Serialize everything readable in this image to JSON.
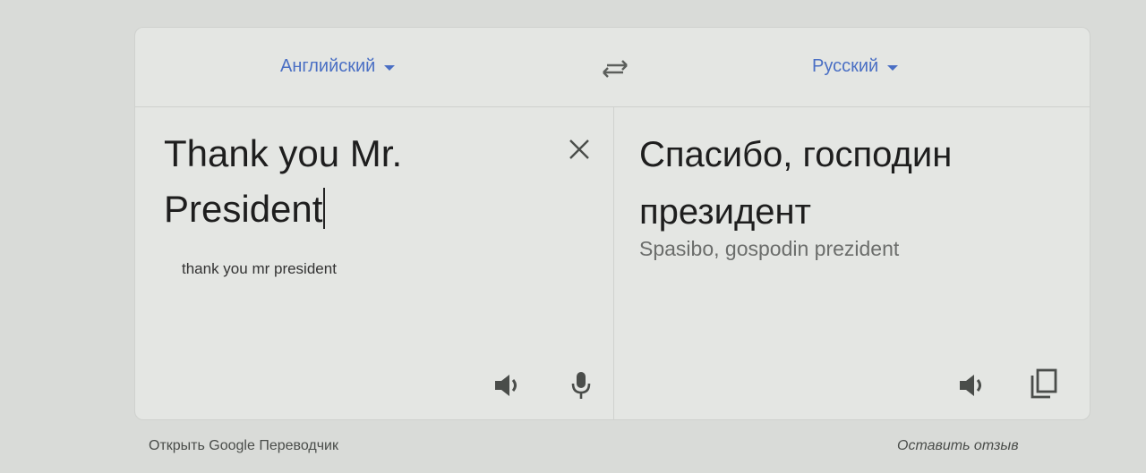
{
  "header": {
    "source_language": "Английский",
    "target_language": "Русский"
  },
  "source": {
    "text": "Thank you Mr. President",
    "transliteration": "thank you mr president"
  },
  "target": {
    "text": "Спасибо, господин президент",
    "transliteration": "Spasibo, gospodin prezident"
  },
  "icons": {
    "swap": "swap-languages-icon",
    "clear": "close-icon",
    "listen": "speaker-icon",
    "voice": "microphone-icon",
    "copy": "copy-icon",
    "dropdown": "chevron-down-icon"
  },
  "footer": {
    "open_link": "Открыть Google Переводчик",
    "feedback_link": "Оставить отзыв"
  },
  "colors": {
    "accent": "#4a6fc4",
    "background": "#d9dbd8",
    "card": "#e4e6e3"
  }
}
